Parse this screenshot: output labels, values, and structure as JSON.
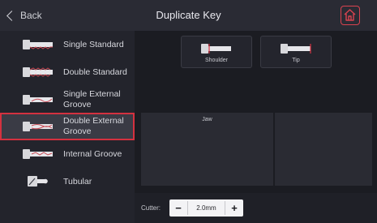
{
  "header": {
    "back_label": "Back",
    "title": "Duplicate Key"
  },
  "sidebar": {
    "items": [
      {
        "label": "Single Standard"
      },
      {
        "label": "Double Standard"
      },
      {
        "label": "Single External Groove"
      },
      {
        "label": "Double External Groove",
        "selected": true
      },
      {
        "label": "Internal Groove"
      },
      {
        "label": "Tubular"
      }
    ]
  },
  "main": {
    "options": [
      {
        "label": "Shoulder"
      },
      {
        "label": "Tip"
      }
    ],
    "panels": [
      {
        "label": "Jaw"
      },
      {
        "label": ""
      }
    ]
  },
  "cutter": {
    "label": "Cutter:",
    "value": "2.0mm",
    "minus": "−",
    "plus": "+"
  },
  "colors": {
    "highlight": "#d4313f",
    "home_accent": "#d9434f"
  }
}
